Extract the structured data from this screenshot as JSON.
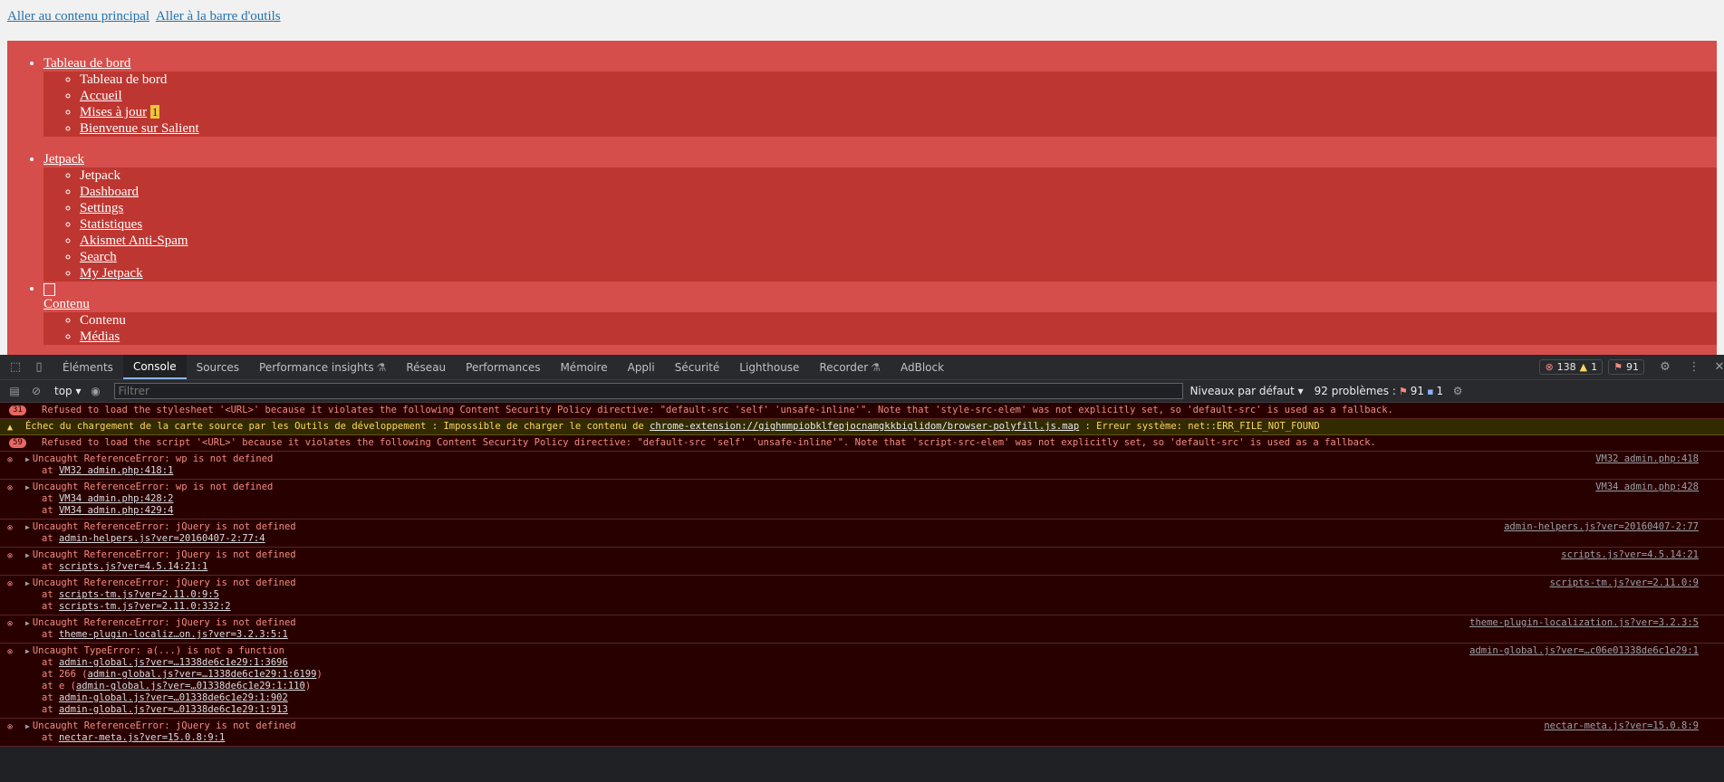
{
  "skip_links": [
    "Aller au contenu principal",
    "Aller à la barre d'outils"
  ],
  "menu": [
    {
      "head": "Tableau de bord",
      "subs": [
        {
          "label": "Tableau de bord",
          "link": false
        },
        {
          "label": "Accueil",
          "link": true
        },
        {
          "label": "Mises à jour",
          "link": true,
          "badge": "1"
        },
        {
          "label": "Bienvenue sur Salient",
          "link": true
        }
      ]
    },
    {
      "head": "Jetpack",
      "subs": [
        {
          "label": "Jetpack",
          "link": false
        },
        {
          "label": "Dashboard",
          "link": true
        },
        {
          "label": "Settings",
          "link": true
        },
        {
          "label": "Statistiques",
          "link": true
        },
        {
          "label": "Akismet Anti-Spam",
          "link": true
        },
        {
          "label": "Search",
          "link": true
        },
        {
          "label": "My Jetpack",
          "link": true
        }
      ]
    },
    {
      "head": "Contenu",
      "icon": true,
      "subs": [
        {
          "label": "Contenu",
          "link": false
        },
        {
          "label": "Médias",
          "link": true
        }
      ]
    }
  ],
  "devtools": {
    "tabs": [
      "Éléments",
      "Console",
      "Sources",
      "Performance insights",
      "Réseau",
      "Performances",
      "Mémoire",
      "Appli",
      "Sécurité",
      "Lighthouse",
      "Recorder",
      "AdBlock"
    ],
    "active_tab": "Console",
    "counts": {
      "errors": "138",
      "warnings": "1",
      "issues": "91"
    },
    "context": "top",
    "filter_placeholder": "Filtrer",
    "levels": "Niveaux par défaut",
    "problems_label": "92 problèmes :",
    "problems_err": "91",
    "problems_info": "1"
  },
  "console": [
    {
      "kind": "csp",
      "count": "31",
      "text": "Refused to load the stylesheet '<URL>' because it violates the following Content Security Policy directive: \"default-src 'self' 'unsafe-inline'\". Note that 'style-src-elem' was not explicitly set, so 'default-src' is used as a fallback."
    },
    {
      "kind": "warn",
      "text_pre": "Échec du chargement de la carte source par les Outils de développement : Impossible de charger le contenu de ",
      "link": "chrome-extension://gighmmpiobklfepjocnamgkkbiglidom/browser-polyfill.js.map",
      "text_post": " : Erreur système: net::ERR_FILE_NOT_FOUND"
    },
    {
      "kind": "csp",
      "count": "59",
      "text": "Refused to load the script '<URL>' because it violates the following Content Security Policy directive: \"default-src 'self' 'unsafe-inline'\". Note that 'script-src-elem' was not explicitly set, so 'default-src' is used as a fallback."
    },
    {
      "kind": "err",
      "text": "Uncaught ReferenceError: wp is not defined",
      "src": "VM32 admin.php:418",
      "stack": [
        [
          "at ",
          "VM32 admin.php:418:1",
          ""
        ]
      ]
    },
    {
      "kind": "err",
      "text": "Uncaught ReferenceError: wp is not defined",
      "src": "VM34 admin.php:428",
      "stack": [
        [
          "at ",
          "VM34 admin.php:428:2",
          ""
        ],
        [
          "at ",
          "VM34 admin.php:429:4",
          ""
        ]
      ]
    },
    {
      "kind": "err",
      "text": "Uncaught ReferenceError: jQuery is not defined",
      "src": "admin-helpers.js?ver=20160407-2:77",
      "stack": [
        [
          "at ",
          "admin-helpers.js?ver=20160407-2:77:4",
          ""
        ]
      ]
    },
    {
      "kind": "err",
      "text": "Uncaught ReferenceError: jQuery is not defined",
      "src": "scripts.js?ver=4.5.14:21",
      "stack": [
        [
          "at ",
          "scripts.js?ver=4.5.14:21:1",
          ""
        ]
      ]
    },
    {
      "kind": "err",
      "text": "Uncaught ReferenceError: jQuery is not defined",
      "src": "scripts-tm.js?ver=2.11.0:9",
      "stack": [
        [
          "at ",
          "scripts-tm.js?ver=2.11.0:9:5",
          ""
        ],
        [
          "at ",
          "scripts-tm.js?ver=2.11.0:332:2",
          ""
        ]
      ]
    },
    {
      "kind": "err",
      "text": "Uncaught ReferenceError: jQuery is not defined",
      "src": "theme-plugin-localization.js?ver=3.2.3:5",
      "stack": [
        [
          "at ",
          "theme-plugin-localiz…on.js?ver=3.2.3:5:1",
          ""
        ]
      ]
    },
    {
      "kind": "err",
      "text": "Uncaught TypeError: a(...) is not a function",
      "src": "admin-global.js?ver=…c06e01338de6c1e29:1",
      "stack": [
        [
          "at ",
          "admin-global.js?ver=…1338de6c1e29:1:3696",
          ""
        ],
        [
          "at 266 (",
          "admin-global.js?ver=…1338de6c1e29:1:6199",
          ")"
        ],
        [
          "at e (",
          "admin-global.js?ver=…01338de6c1e29:1:110",
          ")"
        ],
        [
          "at ",
          "admin-global.js?ver=…01338de6c1e29:1:902",
          ""
        ],
        [
          "at ",
          "admin-global.js?ver=…01338de6c1e29:1:913",
          ""
        ]
      ]
    },
    {
      "kind": "err",
      "text": "Uncaught ReferenceError: jQuery is not defined",
      "src": "nectar-meta.js?ver=15.0.8:9",
      "stack": [
        [
          "at ",
          "nectar-meta.js?ver=15.0.8:9:1",
          ""
        ]
      ]
    }
  ]
}
